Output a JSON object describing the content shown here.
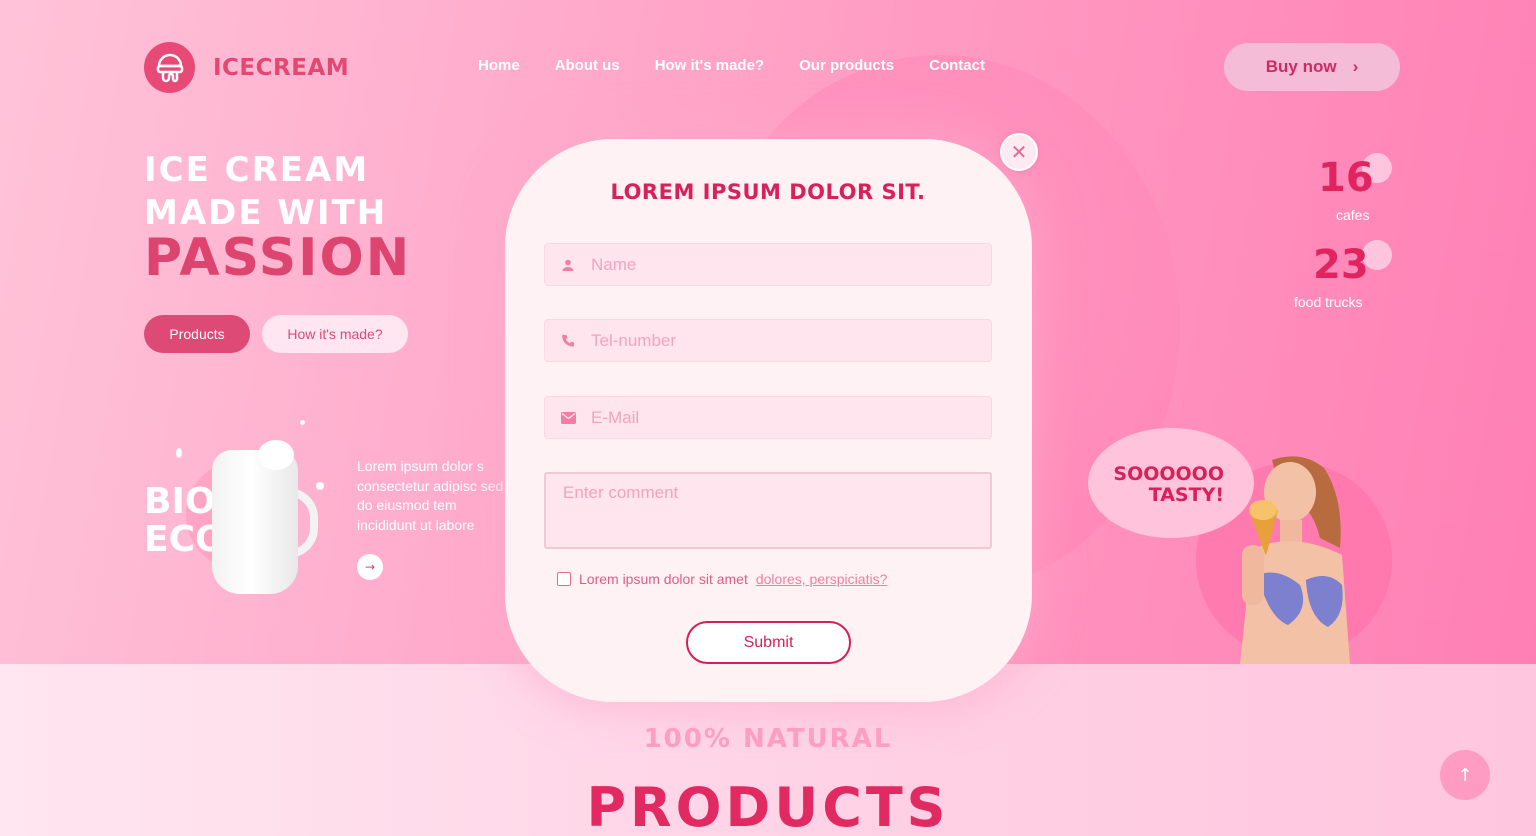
{
  "brand": {
    "name": "ICECREAM",
    "icon": "ice-cream-icon"
  },
  "nav": [
    "Home",
    "About us",
    "How it's made?",
    "Our products",
    "Contact"
  ],
  "header": {
    "buy_label": "Buy now",
    "buy_icon": "chevron-right-icon"
  },
  "hero": {
    "line1": "ICE CREAM",
    "line2": "MADE WITH",
    "line3": "PASSION",
    "btn_products": "Products",
    "btn_how": "How it's made?",
    "bio_line1": "BIO",
    "bio_line2": "ECO",
    "lorem": "Lorem ipsum dolor s consectetur adipisc sed do eiusmod tem incididunt ut labore"
  },
  "stats": [
    {
      "value": "16",
      "label": "cafes"
    },
    {
      "value": "23",
      "label": "food trucks"
    }
  ],
  "bubble": {
    "line1": "SOOOOOO",
    "line2": "TASTY!"
  },
  "section": {
    "subtitle": "100% NATURAL",
    "title": "PRODUCTS"
  },
  "modal": {
    "title": "LOREM IPSUM DOLOR SIT.",
    "name_placeholder": "Name",
    "tel_placeholder": "Tel-number",
    "email_placeholder": "E-Mail",
    "comment_placeholder": "Enter comment",
    "agree_text": "Lorem ipsum dolor sit amet",
    "agree_link": "dolores, perspiciatis?",
    "submit_label": "Submit"
  },
  "colors": {
    "accent": "#d8205a",
    "brand": "#e24873",
    "modal_bg": "#fff2f5"
  }
}
